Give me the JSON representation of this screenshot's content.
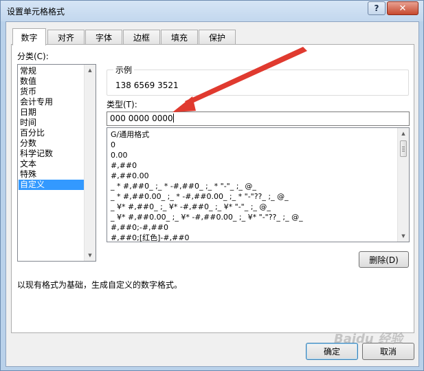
{
  "window": {
    "title": "设置单元格格式",
    "help_label": "?",
    "close_label": "✕"
  },
  "tabs": [
    {
      "label": "数字",
      "active": true
    },
    {
      "label": "对齐",
      "active": false
    },
    {
      "label": "字体",
      "active": false
    },
    {
      "label": "边框",
      "active": false
    },
    {
      "label": "填充",
      "active": false
    },
    {
      "label": "保护",
      "active": false
    }
  ],
  "category": {
    "label": "分类(C):",
    "items": [
      "常规",
      "数值",
      "货币",
      "会计专用",
      "日期",
      "时间",
      "百分比",
      "分数",
      "科学记数",
      "文本",
      "特殊",
      "自定义"
    ],
    "selected": "自定义"
  },
  "sample": {
    "label": "示例",
    "value": "138 6569 3521"
  },
  "type": {
    "label": "类型(T):",
    "value": "000 0000 0000"
  },
  "formats": [
    "G/通用格式",
    "0",
    "0.00",
    "#,##0",
    "#,##0.00",
    "_ * #,##0_ ;_ * -#,##0_ ;_ * \"-\"_ ;_ @_",
    "_ * #,##0.00_ ;_ * -#,##0.00_ ;_ * \"-\"??_ ;_ @_",
    "_ ¥* #,##0_ ;_ ¥* -#,##0_ ;_ ¥* \"-\"_ ;_ @_",
    "_ ¥* #,##0.00_ ;_ ¥* -#,##0.00_ ;_ ¥* \"-\"??_ ;_ @_",
    "#,##0;-#,##0",
    "#,##0;[红色]-#,##0"
  ],
  "delete_button": "删除(D)",
  "description": "以现有格式为基础，生成自定义的数字格式。",
  "ok_button": "确定",
  "cancel_button": "取消",
  "watermark": "Baidu 经验",
  "colors": {
    "selection": "#3399ff",
    "annotation_arrow": "#e03a2f",
    "titlebar": "#c2d7ee"
  }
}
